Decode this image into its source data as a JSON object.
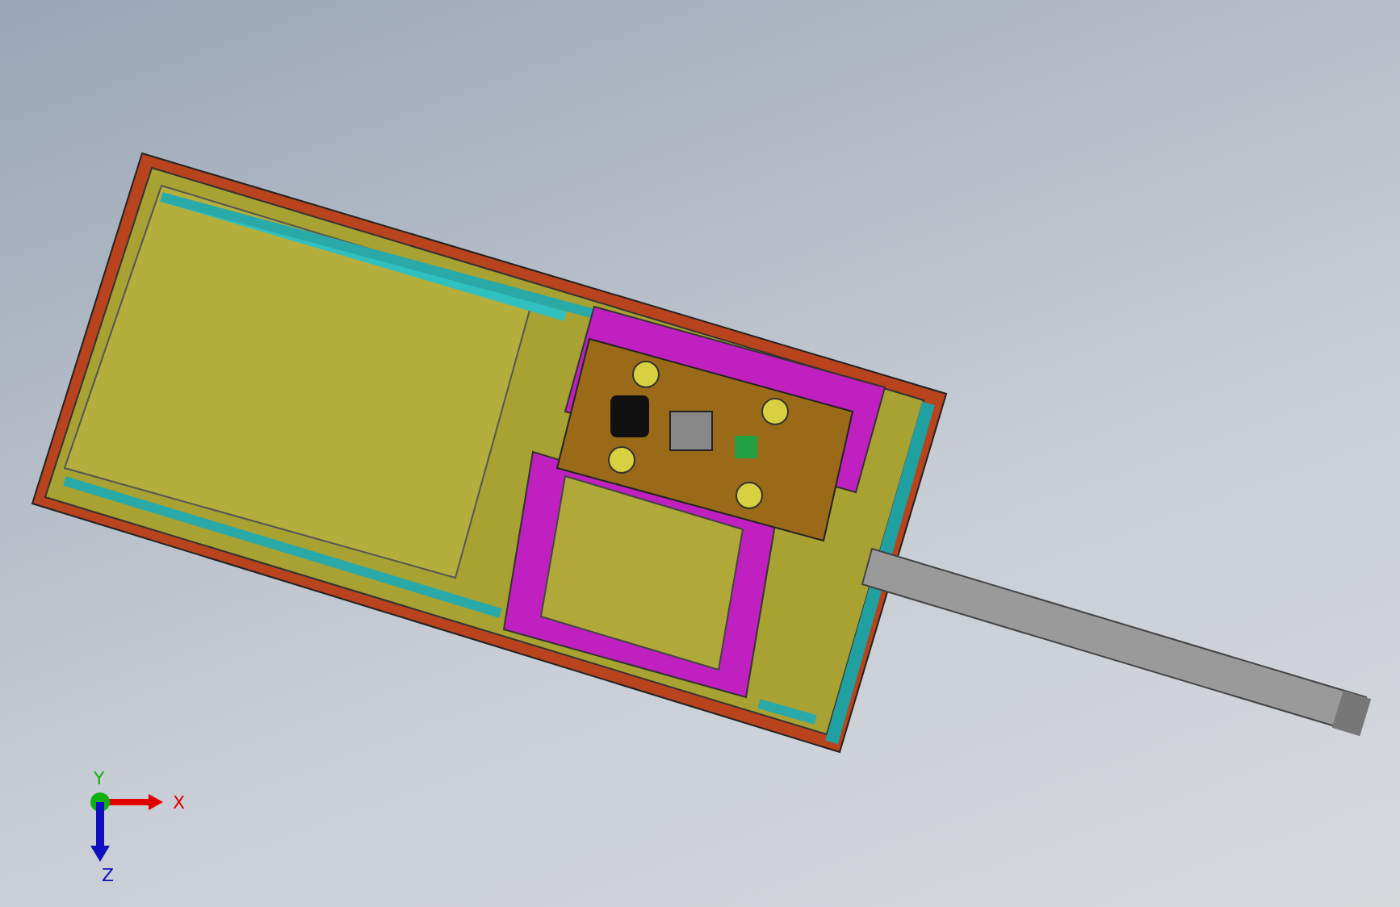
{
  "viewport": {
    "triad": {
      "axes": [
        {
          "kind": "x",
          "label": "X"
        },
        {
          "kind": "y",
          "label": "Y"
        },
        {
          "kind": "z",
          "label": "Z"
        }
      ]
    }
  }
}
